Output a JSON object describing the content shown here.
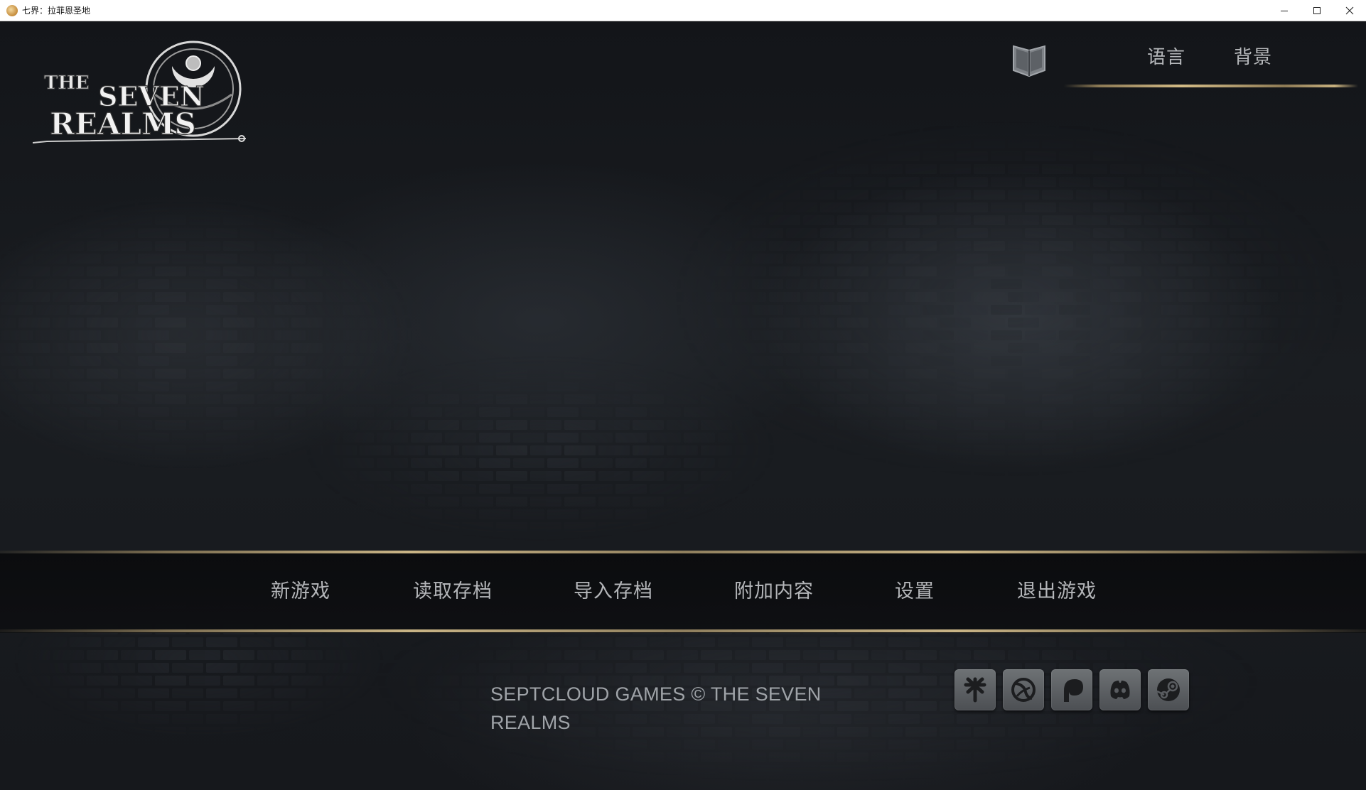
{
  "window": {
    "title": "七界：拉菲恩圣地"
  },
  "logo": {
    "line1": "THE",
    "line2": "SEVEN",
    "line3": "REALMS"
  },
  "top_nav": {
    "lore_icon": "open-book-icon",
    "language": "语言",
    "background": "背景"
  },
  "main_menu": {
    "items": [
      {
        "label": "新游戏"
      },
      {
        "label": "读取存档"
      },
      {
        "label": "导入存档"
      },
      {
        "label": "附加内容"
      },
      {
        "label": "设置"
      },
      {
        "label": "退出游戏"
      }
    ]
  },
  "footer": {
    "copyright": "SEPTCLOUD GAMES © THE SEVEN REALMS",
    "social_icons": [
      "linktree-icon",
      "itch-swirl-icon",
      "patreon-icon",
      "discord-icon",
      "steam-icon"
    ]
  },
  "colors": {
    "background": "#15171a",
    "menu_text": "#b4b6b9",
    "gold_accent": "#c9b486"
  }
}
